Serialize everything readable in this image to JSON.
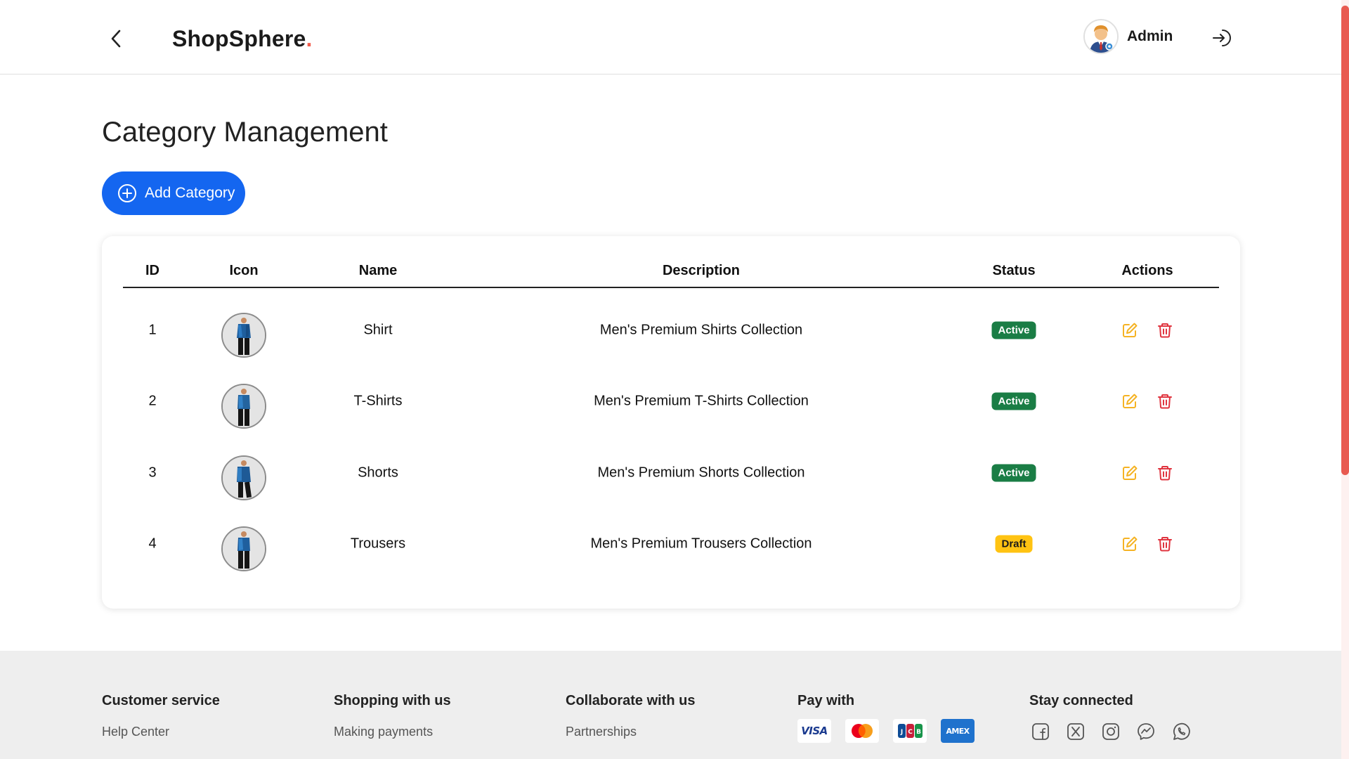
{
  "header": {
    "brand_name": "ShopSphere",
    "brand_dot": ".",
    "user_name": "Admin"
  },
  "main": {
    "title": "Category Management",
    "add_button_label": "Add Category"
  },
  "table": {
    "headers": {
      "id": "ID",
      "icon": "Icon",
      "name": "Name",
      "description": "Description",
      "status": "Status",
      "actions": "Actions"
    },
    "rows": [
      {
        "id": "1",
        "name": "Shirt",
        "description": "Men's Premium Shirts Collection",
        "status": "Active"
      },
      {
        "id": "2",
        "name": "T-Shirts",
        "description": "Men's Premium T-Shirts Collection",
        "status": "Active"
      },
      {
        "id": "3",
        "name": "Shorts",
        "description": "Men's Premium Shorts Collection",
        "status": "Active"
      },
      {
        "id": "4",
        "name": "Trousers",
        "description": "Men's Premium Trousers Collection",
        "status": "Draft"
      }
    ]
  },
  "footer": {
    "customer_service": {
      "heading": "Customer service",
      "links": [
        "Help Center"
      ]
    },
    "shopping": {
      "heading": "Shopping with us",
      "links": [
        "Making payments"
      ]
    },
    "collaborate": {
      "heading": "Collaborate with us",
      "links": [
        "Partnerships"
      ]
    },
    "pay_with": {
      "heading": "Pay with",
      "methods": [
        "VISA",
        "mastercard",
        "JCB",
        "AMEX"
      ]
    },
    "stay_connected": {
      "heading": "Stay connected",
      "icons": [
        "facebook-icon",
        "x-twitter-icon",
        "instagram-icon",
        "messenger-icon",
        "whatsapp-icon"
      ]
    }
  },
  "colors": {
    "accent_blue": "#1466f0",
    "brand_dot": "#f25c4c",
    "active_badge": "#1a7d45",
    "draft_badge": "#ffc312",
    "edit_icon": "#f5b324",
    "delete_icon": "#e0343f"
  }
}
